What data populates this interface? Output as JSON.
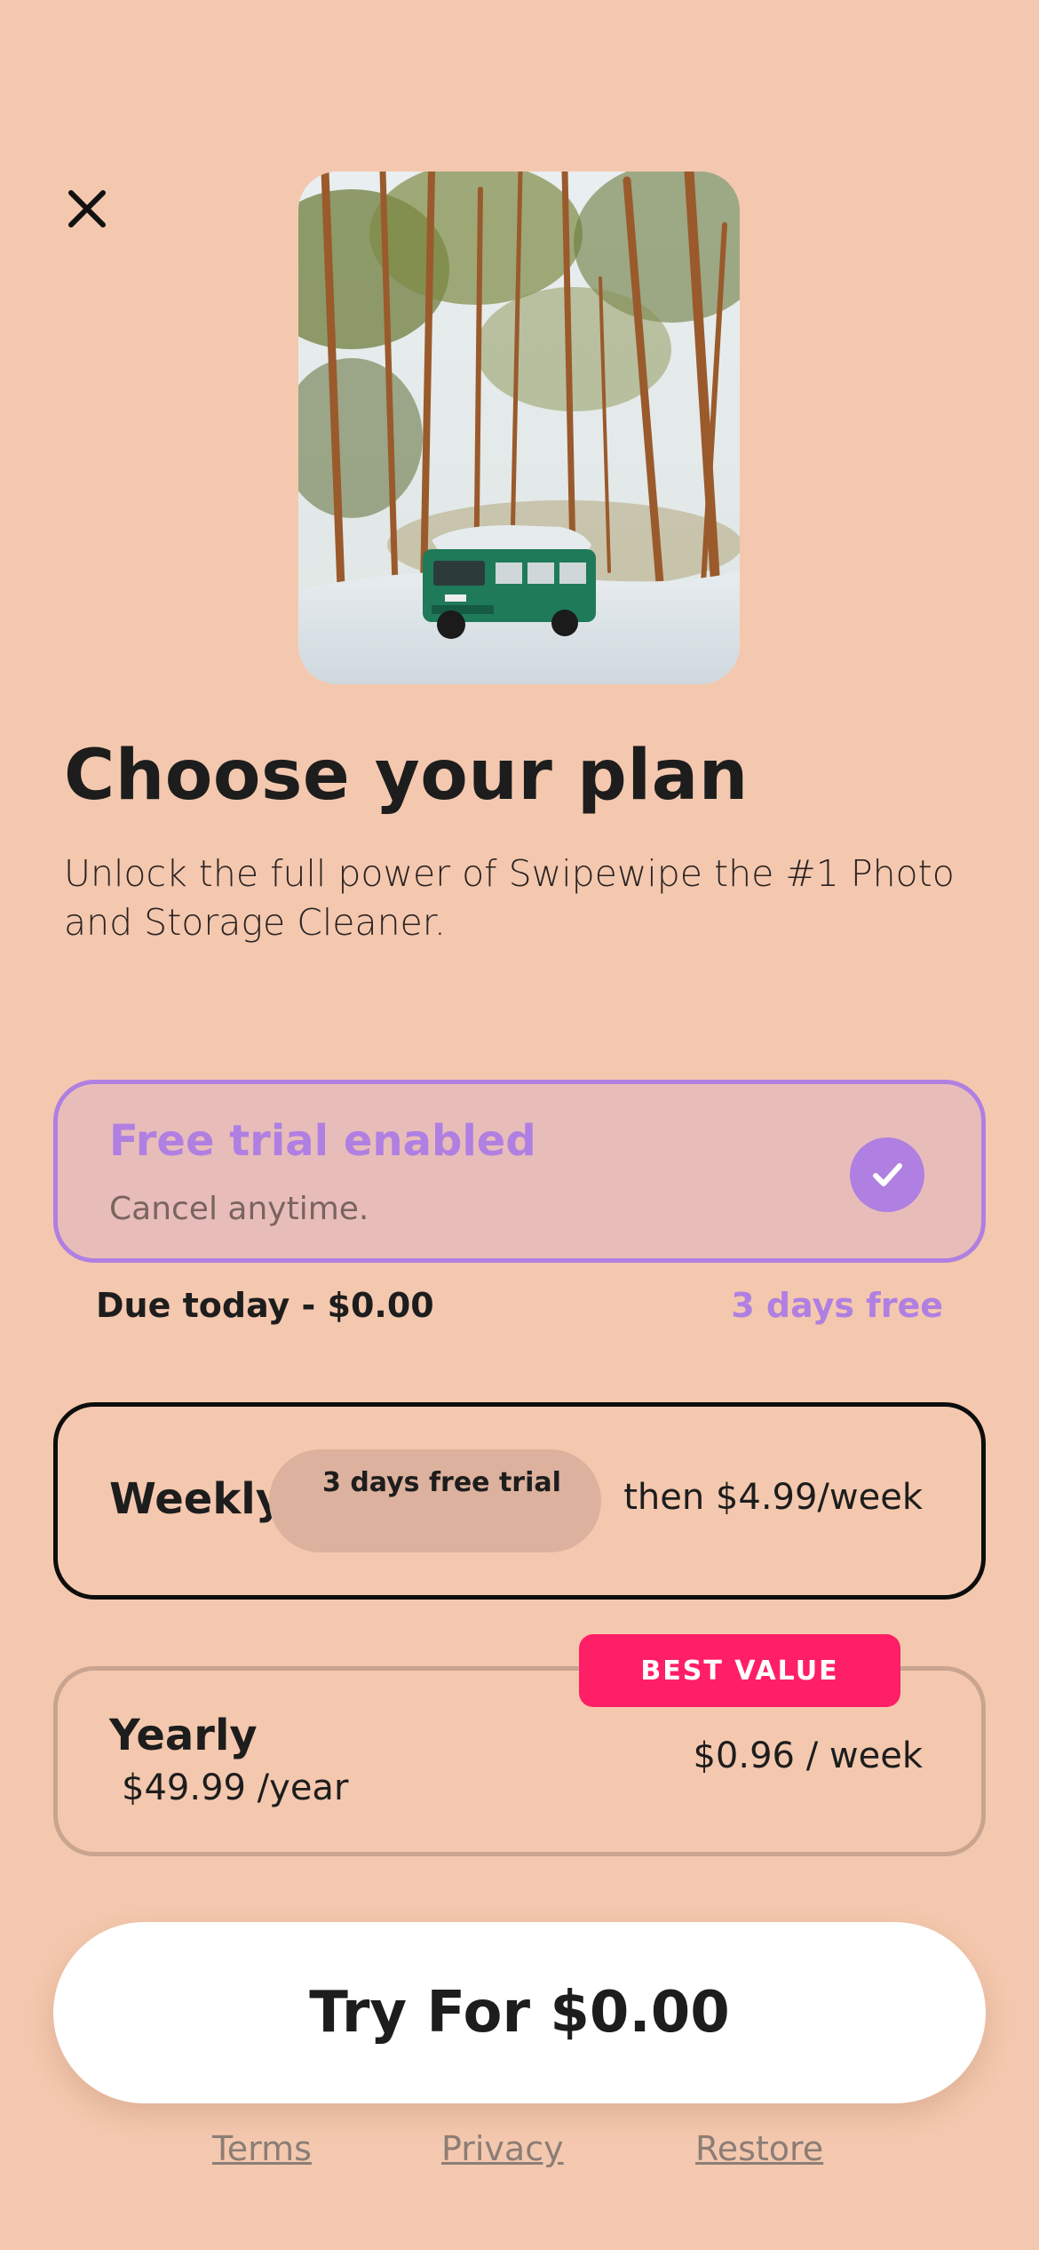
{
  "header": {
    "close_icon": "close-icon"
  },
  "hero": {
    "image": "forest-van-photo"
  },
  "title": "Choose your plan",
  "subtitle": "Unlock the full power of Swipewipe the #1 Photo and Storage Cleaner.",
  "trial_toggle": {
    "title": "Free trial enabled",
    "subtitle": "Cancel anytime.",
    "checked": true,
    "check_icon": "checkmark-icon"
  },
  "summary": {
    "due_today": "Due today - $0.00",
    "trial_length": "3 days free"
  },
  "plans": {
    "weekly": {
      "name": "Weekly",
      "badge": "3 days free trial",
      "price": "then $4.99/week",
      "selected": true
    },
    "yearly": {
      "name": "Yearly",
      "sub_price": "$49.99 /year",
      "price": "$0.96 / week",
      "badge": "BEST VALUE",
      "selected": false
    }
  },
  "cta_label": "Try For $0.00",
  "footer": {
    "terms": "Terms",
    "privacy": "Privacy",
    "restore": "Restore"
  },
  "colors": {
    "background": "#F4C8AE",
    "accent_purple": "#B07FE2",
    "best_value": "#FF1F66",
    "cta_background": "#FFFFFF"
  }
}
